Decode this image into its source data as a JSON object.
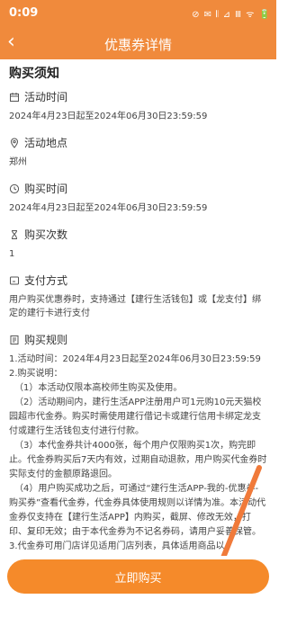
{
  "status": {
    "time": "0:09",
    "icons": "⊘ ✉ 𝄃 ⊿ Ⅲ ᯤ 🔋"
  },
  "nav": {
    "back": "‹",
    "title": "优惠券详情"
  },
  "notice_title": "购买须知",
  "sections": {
    "activity_time": {
      "title": "活动时间",
      "value": "2024年4月23日起至2024年06月30日23:59:59"
    },
    "activity_place": {
      "title": "活动地点",
      "value": "郑州"
    },
    "purchase_time": {
      "title": "购买时间",
      "value": "2024年4月23日起至2024年06月30日23:59:59"
    },
    "purchase_count": {
      "title": "购买次数",
      "value": "1"
    },
    "payment": {
      "title": "支付方式",
      "value": "用户购买优惠券时，支持通过【建行生活钱包】或【龙支付】绑定的建行卡进行支付"
    },
    "rules": {
      "title": "购买规则",
      "lines": [
        "1.活动时间：2024年4月23日起至2024年06月30日23:59:59",
        "2.购买说明：",
        "（1）本活动仅限本高校师生购买及使用。",
        "（2）活动期间内，建行生活APP注册用户可1元购10元天猫校园超市代金券。购买时需使用建行借记卡或建行信用卡绑定龙支付或建行生活钱包支付进行付款。",
        "（3）本代金券共计4000张，每个用户仅限购买1次，购完即止。代金券购买后7天内有效，过期自动退款，用户购买代金券时实际支付的金额原路退回。",
        "（4）用户购买成功之后，可通过“建行生活APP-我的-优惠券-购买券”查看代金券，代金券具体使用规则以详情为准。本活动代金券仅支持在【建行生活APP】内购买，截屏、修改无效，打印、复印无效；由于本代金券为不记名券码，请用户妥善保管。",
        "3.代金券可用门店详见适用门店列表，具体适用商品以"
      ]
    }
  },
  "buy_button": "立即购买",
  "colors": {
    "brand": "#f08a3c",
    "button": "#f58a2a",
    "annotation_arrow": "#f07a3a"
  }
}
